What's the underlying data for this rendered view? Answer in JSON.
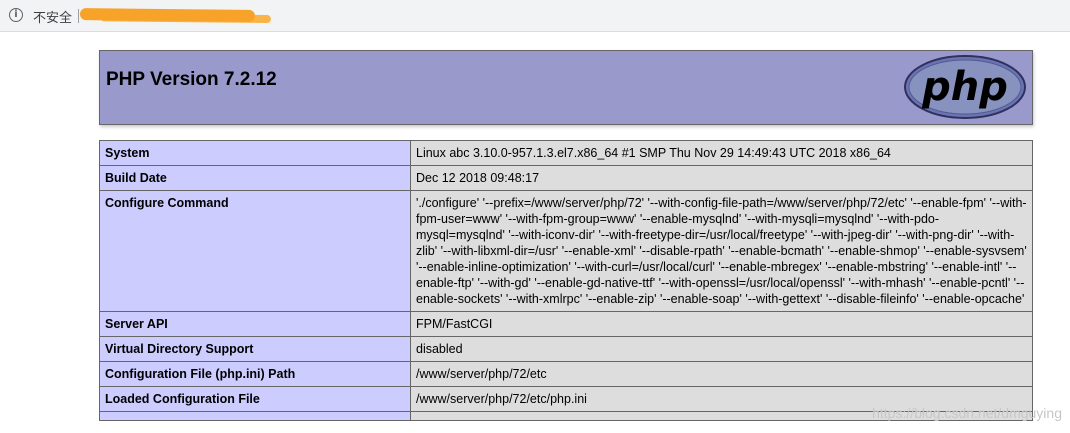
{
  "browser": {
    "info_icon": "info-icon",
    "security_label": "不安全",
    "url_redacted": true
  },
  "phpinfo": {
    "title": "PHP Version 7.2.12",
    "logo_text": "php",
    "rows": [
      {
        "key": "System",
        "value": "Linux abc 3.10.0-957.1.3.el7.x86_64 #1 SMP Thu Nov 29 14:49:43 UTC 2018 x86_64"
      },
      {
        "key": "Build Date",
        "value": "Dec 12 2018 09:48:17"
      },
      {
        "key": "Configure Command",
        "value": "'./configure' '--prefix=/www/server/php/72' '--with-config-file-path=/www/server/php/72/etc' '--enable-fpm' '--with-fpm-user=www' '--with-fpm-group=www' '--enable-mysqlnd' '--with-mysqli=mysqlnd' '--with-pdo-mysql=mysqlnd' '--with-iconv-dir' '--with-freetype-dir=/usr/local/freetype' '--with-jpeg-dir' '--with-png-dir' '--with-zlib' '--with-libxml-dir=/usr' '--enable-xml' '--disable-rpath' '--enable-bcmath' '--enable-shmop' '--enable-sysvsem' '--enable-inline-optimization' '--with-curl=/usr/local/curl' '--enable-mbregex' '--enable-mbstring' '--enable-intl' '--enable-ftp' '--with-gd' '--enable-gd-native-ttf' '--with-openssl=/usr/local/openssl' '--with-mhash' '--enable-pcntl' '--enable-sockets' '--with-xmlrpc' '--enable-zip' '--enable-soap' '--with-gettext' '--disable-fileinfo' '--enable-opcache'"
      },
      {
        "key": "Server API",
        "value": "FPM/FastCGI"
      },
      {
        "key": "Virtual Directory Support",
        "value": "disabled"
      },
      {
        "key": "Configuration File (php.ini) Path",
        "value": "/www/server/php/72/etc"
      },
      {
        "key": "Loaded Configuration File",
        "value": "/www/server/php/72/etc/php.ini"
      },
      {
        "key": "",
        "value": ""
      }
    ]
  },
  "watermark": "https://blog.csdn.net/dmguying",
  "colors": {
    "header_bg": "#9999cc",
    "key_bg": "#ccccff",
    "value_bg": "#dddddd",
    "border": "#666666"
  }
}
